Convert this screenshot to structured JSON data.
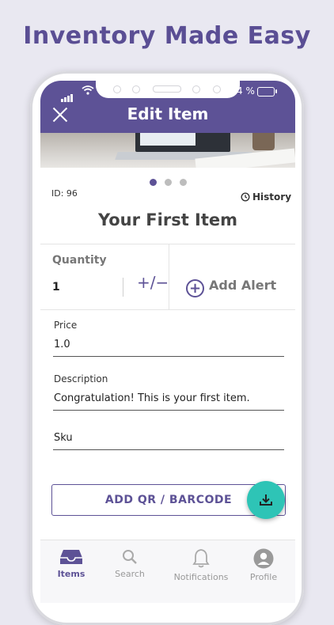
{
  "headline": "Inventory Made Easy",
  "status": {
    "battery": "4 %"
  },
  "appbar": {
    "title": "Edit Item"
  },
  "item": {
    "id_label": "ID: 96",
    "history_label": "History",
    "name": "Your First Item",
    "quantity_label": "Quantity",
    "quantity_value": "1",
    "stepper_label": "+/−",
    "add_alert_label": "Add Alert"
  },
  "fields": {
    "price_label": "Price",
    "price_value": "1.0",
    "description_label": "Description",
    "description_value": "Congratulation! This is your first item.",
    "sku_placeholder": "Sku"
  },
  "actions": {
    "qr_label": "ADD QR / BARCODE"
  },
  "tabs": [
    {
      "label": "Items",
      "icon": "inbox-tray-icon"
    },
    {
      "label": "Search",
      "icon": "search-icon"
    },
    {
      "label": "Notifications",
      "icon": "bell-icon"
    },
    {
      "label": "Profile",
      "icon": "person-icon"
    }
  ],
  "colors": {
    "primary": "#5d5296",
    "accent": "#2ec4b6",
    "background": "#e9e8f1"
  }
}
